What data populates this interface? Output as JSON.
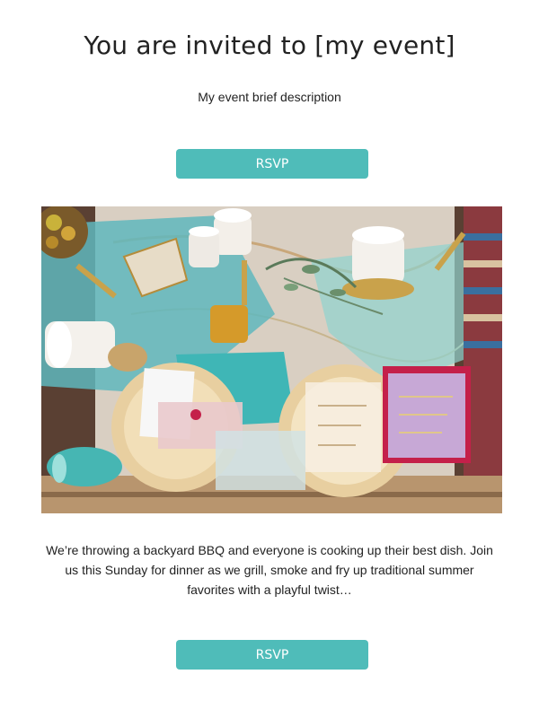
{
  "header": {
    "title": "You are invited to [my event]",
    "description": "My event brief description"
  },
  "rsvp": {
    "top_label": "RSVP",
    "bottom_label": "RSVP",
    "color": "#4fbcb9"
  },
  "main": {
    "body_text": "We’re throwing a backyard BBQ and everyone is cooking up their best dish. Join us this Sunday for dinner as we grill, smoke and fry up traditional summer favorites with a playful twist…"
  }
}
